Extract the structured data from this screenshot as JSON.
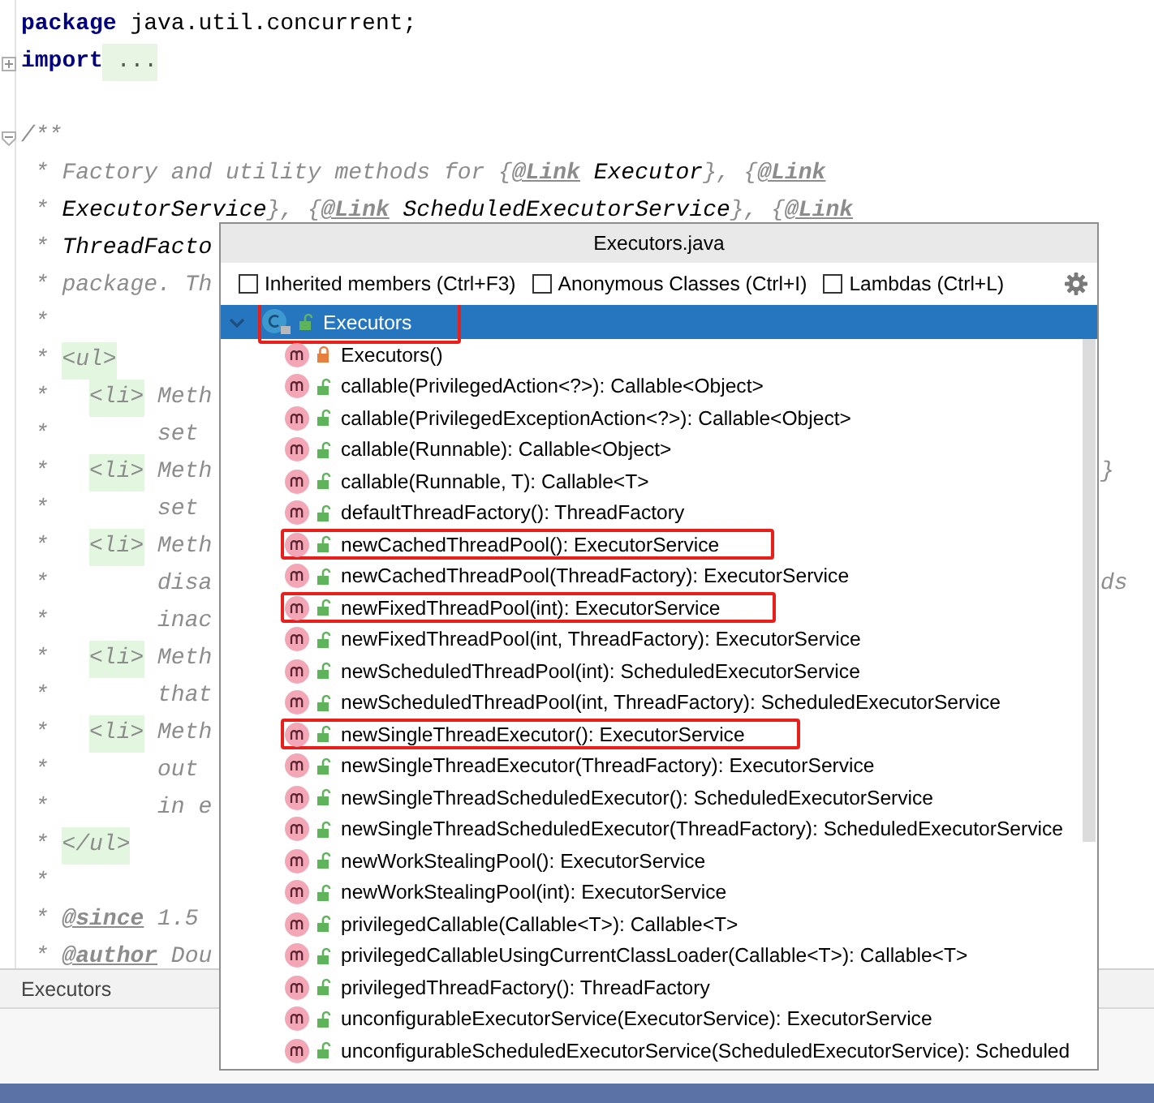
{
  "editor": {
    "lines": [
      {
        "segments": [
          {
            "text": "package",
            "kind": "keyword"
          },
          {
            "text": " java.util.concurrent;",
            "kind": "plain"
          }
        ]
      },
      {
        "segments": [
          {
            "text": "import",
            "kind": "keyword"
          },
          {
            "text": " ...",
            "kind": "fold"
          }
        ]
      },
      {
        "gap_before": true,
        "segments": [
          {
            "text": "/**",
            "kind": "doc"
          }
        ]
      },
      {
        "segments": [
          {
            "text": " * Factory and utility methods for {",
            "kind": "doc"
          },
          {
            "text": "@Link",
            "kind": "link"
          },
          {
            "text": " Executor",
            "kind": "docref"
          },
          {
            "text": "}, {",
            "kind": "doc"
          },
          {
            "text": "@Link",
            "kind": "link"
          }
        ]
      },
      {
        "segments": [
          {
            "text": " * ",
            "kind": "doc"
          },
          {
            "text": "ExecutorService",
            "kind": "docref"
          },
          {
            "text": "}, {",
            "kind": "doc"
          },
          {
            "text": "@Link",
            "kind": "link"
          },
          {
            "text": " ScheduledExecutorService",
            "kind": "docref"
          },
          {
            "text": "}, {",
            "kind": "doc"
          },
          {
            "text": "@Link",
            "kind": "link"
          }
        ]
      },
      {
        "segments": [
          {
            "text": " * ",
            "kind": "doc"
          },
          {
            "text": "ThreadFacto",
            "kind": "docref"
          }
        ]
      },
      {
        "segments": [
          {
            "text": " * package. Th",
            "kind": "doc"
          }
        ]
      },
      {
        "segments": [
          {
            "text": " *",
            "kind": "doc"
          }
        ]
      },
      {
        "segments": [
          {
            "text": " * ",
            "kind": "doc"
          },
          {
            "text": "<ul>",
            "kind": "doctag"
          }
        ]
      },
      {
        "segments": [
          {
            "text": " *   ",
            "kind": "doc"
          },
          {
            "text": "<li>",
            "kind": "doctag"
          },
          {
            "text": " Meth",
            "kind": "doc"
          }
        ]
      },
      {
        "segments": [
          {
            "text": " *        set",
            "kind": "doc"
          }
        ]
      },
      {
        "segments": [
          {
            "text": " *   ",
            "kind": "doc"
          },
          {
            "text": "<li>",
            "kind": "doctag"
          },
          {
            "text": " Meth",
            "kind": "doc"
          }
        ],
        "tail": "}"
      },
      {
        "segments": [
          {
            "text": " *        set",
            "kind": "doc"
          }
        ]
      },
      {
        "segments": [
          {
            "text": " *   ",
            "kind": "doc"
          },
          {
            "text": "<li>",
            "kind": "doctag"
          },
          {
            "text": " Meth",
            "kind": "doc"
          }
        ]
      },
      {
        "segments": [
          {
            "text": " *        disa",
            "kind": "doc"
          }
        ],
        "tail": "ds"
      },
      {
        "segments": [
          {
            "text": " *        inac",
            "kind": "doc"
          }
        ]
      },
      {
        "segments": [
          {
            "text": " *   ",
            "kind": "doc"
          },
          {
            "text": "<li>",
            "kind": "doctag"
          },
          {
            "text": " Meth",
            "kind": "doc"
          }
        ]
      },
      {
        "segments": [
          {
            "text": " *        that",
            "kind": "doc"
          }
        ]
      },
      {
        "segments": [
          {
            "text": " *   ",
            "kind": "doc"
          },
          {
            "text": "<li>",
            "kind": "doctag"
          },
          {
            "text": " Meth",
            "kind": "doc"
          }
        ]
      },
      {
        "segments": [
          {
            "text": " *        out",
            "kind": "doc"
          }
        ]
      },
      {
        "segments": [
          {
            "text": " *        in e",
            "kind": "doc"
          }
        ]
      },
      {
        "segments": [
          {
            "text": " * ",
            "kind": "doc"
          },
          {
            "text": "</ul>",
            "kind": "doctag"
          }
        ]
      },
      {
        "segments": [
          {
            "text": " *",
            "kind": "doc"
          }
        ]
      },
      {
        "segments": [
          {
            "text": " * ",
            "kind": "doc"
          },
          {
            "text": "@since",
            "kind": "link"
          },
          {
            "text": " 1.5",
            "kind": "doc"
          }
        ]
      },
      {
        "segments": [
          {
            "text": " * ",
            "kind": "doc"
          },
          {
            "text": "@author",
            "kind": "link"
          },
          {
            "text": " Dou",
            "kind": "doc"
          }
        ]
      }
    ]
  },
  "breadcrumb": "Executors",
  "popup": {
    "title": "Executors.java",
    "options": [
      {
        "label": "Inherited members (Ctrl+F3)",
        "checked": false
      },
      {
        "label": "Anonymous Classes (Ctrl+I)",
        "checked": false
      },
      {
        "label": "Lambdas (Ctrl+L)",
        "checked": false
      }
    ],
    "root": {
      "label": "Executors",
      "expanded": true,
      "selected": true,
      "highlighted": true,
      "children": [
        {
          "label": "Executors()",
          "private": true,
          "selected": false,
          "highlighted": false
        },
        {
          "label": "callable(PrivilegedAction<?>): Callable<Object>",
          "private": false,
          "selected": false,
          "highlighted": false
        },
        {
          "label": "callable(PrivilegedExceptionAction<?>): Callable<Object>",
          "private": false,
          "selected": false,
          "highlighted": false
        },
        {
          "label": "callable(Runnable): Callable<Object>",
          "private": false,
          "selected": false,
          "highlighted": false
        },
        {
          "label": "callable(Runnable, T): Callable<T>",
          "private": false,
          "selected": false,
          "highlighted": false
        },
        {
          "label": "defaultThreadFactory(): ThreadFactory",
          "private": false,
          "selected": false,
          "highlighted": false
        },
        {
          "label": "newCachedThreadPool(): ExecutorService",
          "private": false,
          "selected": false,
          "highlighted": true
        },
        {
          "label": "newCachedThreadPool(ThreadFactory): ExecutorService",
          "private": false,
          "selected": false,
          "highlighted": false
        },
        {
          "label": "newFixedThreadPool(int): ExecutorService",
          "private": false,
          "selected": false,
          "highlighted": true
        },
        {
          "label": "newFixedThreadPool(int, ThreadFactory): ExecutorService",
          "private": false,
          "selected": false,
          "highlighted": false
        },
        {
          "label": "newScheduledThreadPool(int): ScheduledExecutorService",
          "private": false,
          "selected": false,
          "highlighted": false
        },
        {
          "label": "newScheduledThreadPool(int, ThreadFactory): ScheduledExecutorService",
          "private": false,
          "selected": false,
          "highlighted": false
        },
        {
          "label": "newSingleThreadExecutor(): ExecutorService",
          "private": false,
          "selected": false,
          "highlighted": true
        },
        {
          "label": "newSingleThreadExecutor(ThreadFactory): ExecutorService",
          "private": false,
          "selected": false,
          "highlighted": false
        },
        {
          "label": "newSingleThreadScheduledExecutor(): ScheduledExecutorService",
          "private": false,
          "selected": false,
          "highlighted": false
        },
        {
          "label": "newSingleThreadScheduledExecutor(ThreadFactory): ScheduledExecutorService",
          "private": false,
          "selected": false,
          "highlighted": false
        },
        {
          "label": "newWorkStealingPool(): ExecutorService",
          "private": false,
          "selected": false,
          "highlighted": false
        },
        {
          "label": "newWorkStealingPool(int): ExecutorService",
          "private": false,
          "selected": false,
          "highlighted": false
        },
        {
          "label": "privilegedCallable(Callable<T>): Callable<T>",
          "private": false,
          "selected": false,
          "highlighted": false
        },
        {
          "label": "privilegedCallableUsingCurrentClassLoader(Callable<T>): Callable<T>",
          "private": false,
          "selected": false,
          "highlighted": false
        },
        {
          "label": "privilegedThreadFactory(): ThreadFactory",
          "private": false,
          "selected": false,
          "highlighted": false
        },
        {
          "label": "unconfigurableExecutorService(ExecutorService): ExecutorService",
          "private": false,
          "selected": false,
          "highlighted": false
        },
        {
          "label": "unconfigurableScheduledExecutorService(ScheduledExecutorService): Scheduled",
          "private": false,
          "selected": false,
          "highlighted": false
        }
      ]
    }
  }
}
